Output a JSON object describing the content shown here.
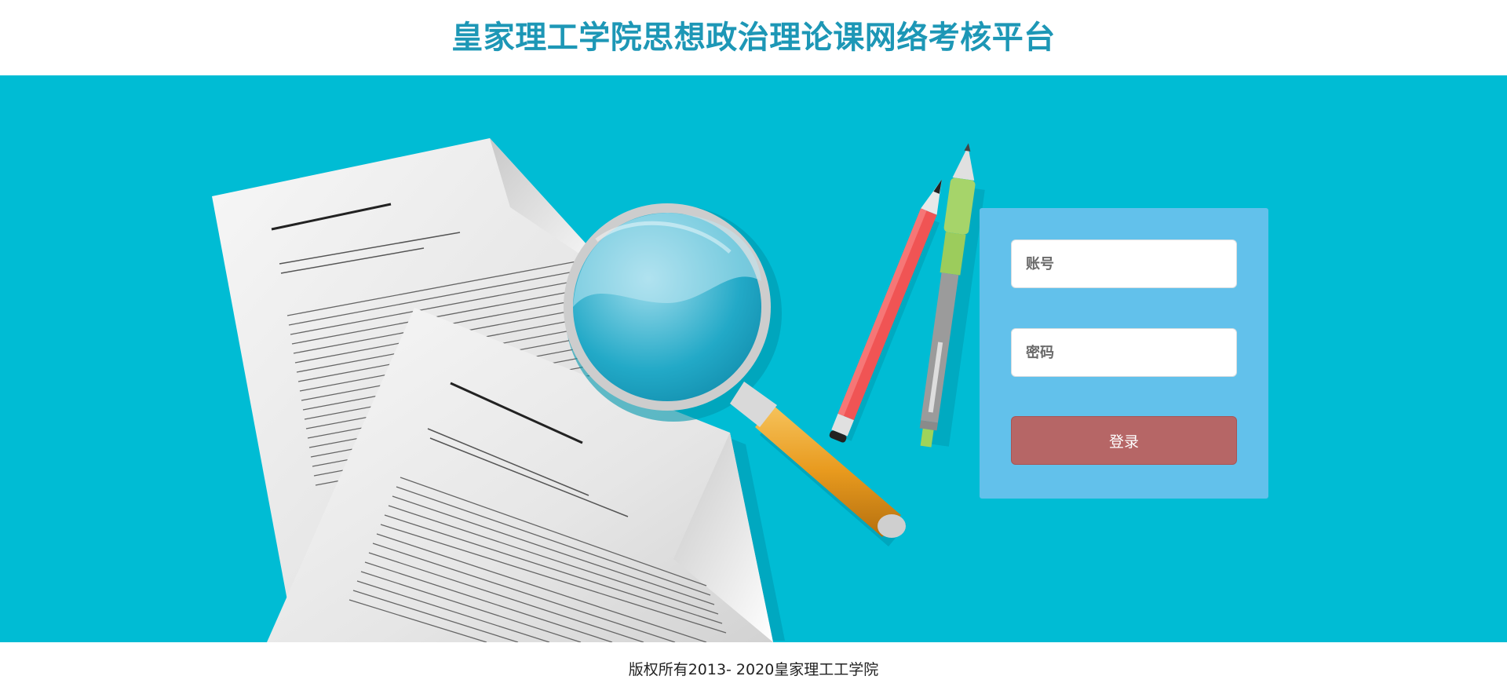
{
  "header": {
    "title": "皇家理工学院思想政治理论课网络考核平台"
  },
  "login": {
    "username_placeholder": "账号",
    "password_placeholder": "密码",
    "submit_label": "登录"
  },
  "footer": {
    "copyright": "版权所有2013- 2020皇家理工工学院"
  },
  "colors": {
    "brand": "#1d97b6",
    "banner": "#00bcd4",
    "panel": "#62c1eb",
    "button": "#b66666"
  },
  "illustration": {
    "icons": [
      "document-icon",
      "magnifying-glass-icon",
      "pencil-icon",
      "pen-icon"
    ]
  }
}
